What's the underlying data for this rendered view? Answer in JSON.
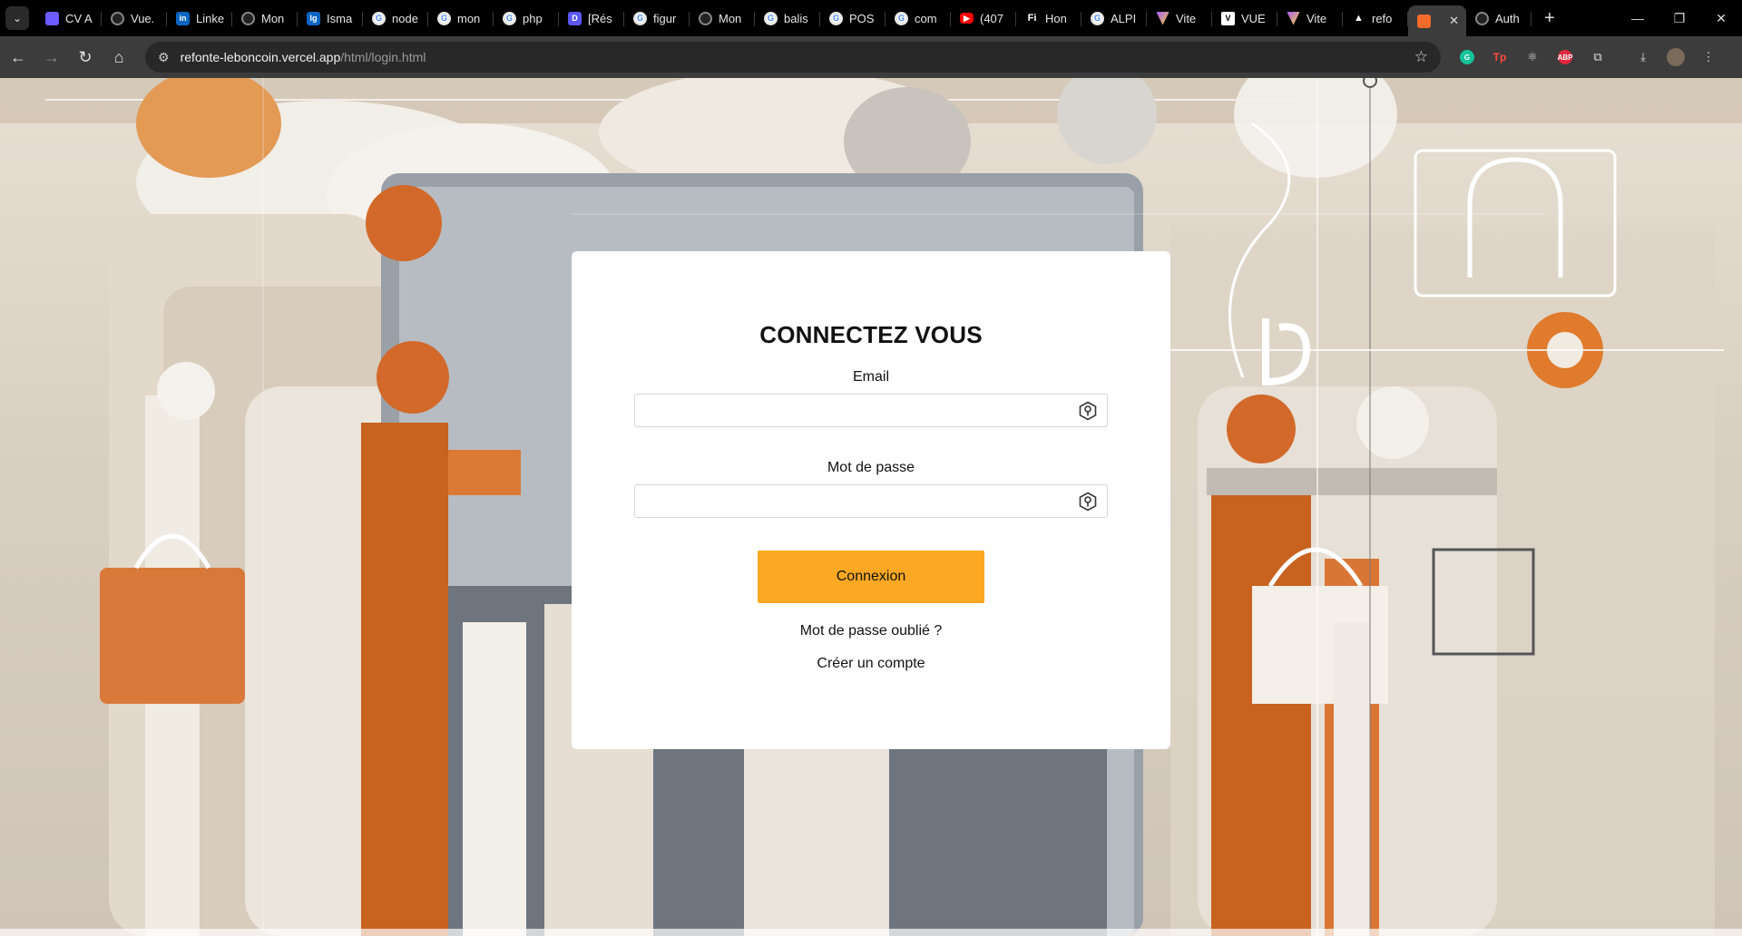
{
  "browser": {
    "tabs": [
      {
        "icon": "canva-icon",
        "label": "CV A"
      },
      {
        "icon": "github-icon",
        "label": "Vue."
      },
      {
        "icon": "linkedin-icon",
        "label": "Linke"
      },
      {
        "icon": "github-icon",
        "label": "Mon"
      },
      {
        "icon": "site-icon",
        "label": "Isma"
      },
      {
        "icon": "google-icon",
        "label": "node"
      },
      {
        "icon": "google-icon",
        "label": "mon"
      },
      {
        "icon": "google-icon",
        "label": "php"
      },
      {
        "icon": "doc-icon",
        "label": "[Rés"
      },
      {
        "icon": "google-icon",
        "label": "figur"
      },
      {
        "icon": "github-icon",
        "label": "Mon"
      },
      {
        "icon": "google-icon",
        "label": "balis"
      },
      {
        "icon": "google-icon",
        "label": "POS"
      },
      {
        "icon": "google-icon",
        "label": "com"
      },
      {
        "icon": "youtube-icon",
        "label": "(407"
      },
      {
        "icon": "fi-icon",
        "label": "Hon"
      },
      {
        "icon": "google-icon",
        "label": "ALPI"
      },
      {
        "icon": "vite-icon",
        "label": "Vite"
      },
      {
        "icon": "vue-icon",
        "label": "VUE"
      },
      {
        "icon": "vite-icon",
        "label": "Vite"
      },
      {
        "icon": "vercel-icon",
        "label": "refo"
      },
      {
        "icon": "leboncoin-icon",
        "label": "",
        "active": true
      },
      {
        "icon": "github-icon",
        "label": "Auth"
      }
    ],
    "url_host": "refonte-leboncoin.vercel.app",
    "url_path": "/html/login.html"
  },
  "login": {
    "title": "CONNECTEZ VOUS",
    "email_label": "Email",
    "email_value": "",
    "password_label": "Mot de passe",
    "password_value": "",
    "submit_label": "Connexion",
    "forgot_label": "Mot de passe oublié ?",
    "signup_label": "Créer un compte"
  },
  "colors": {
    "accent": "#fca823",
    "background_orange": "#d2692a",
    "background_cream": "#ece4d8"
  }
}
